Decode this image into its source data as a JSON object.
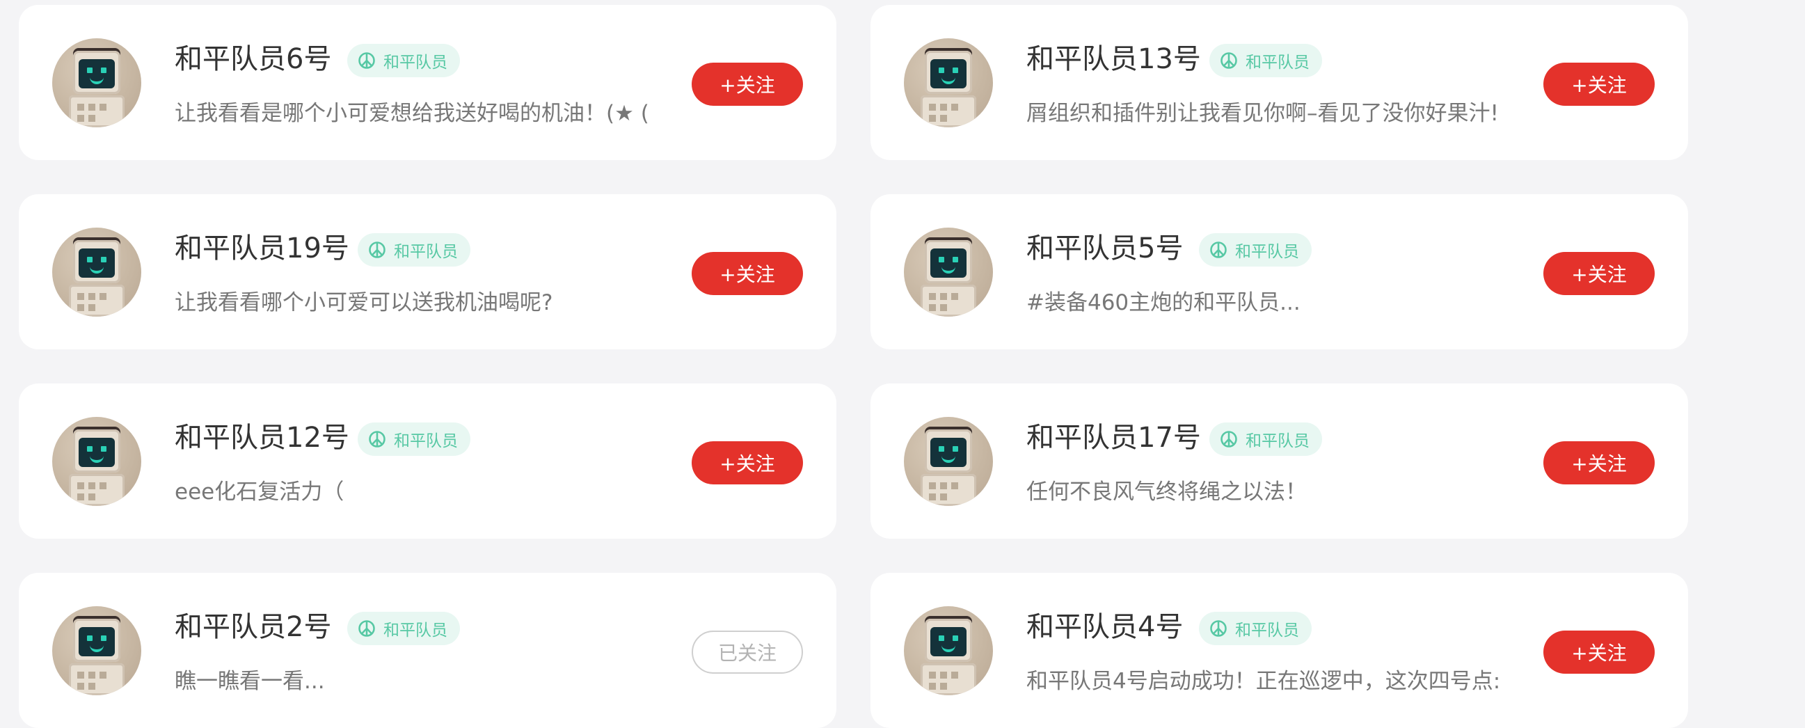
{
  "colors": {
    "accent_red": "#e4322b",
    "badge_text": "#57c8a4",
    "badge_bg": "#e8f7f2",
    "background": "#f4f4f6"
  },
  "cards": [
    {
      "name": "和平队员6号",
      "badge": "和平队员",
      "desc": "让我看看是哪个小可爱想给我送好喝的机油！(★ (",
      "follow_label": "+关注",
      "followed": false
    },
    {
      "name": "和平队员13号",
      "badge": "和平队员",
      "desc": "屑组织和插件别让我看见你啊–看见了没你好果汁!",
      "follow_label": "+关注",
      "followed": false
    },
    {
      "name": "和平队员19号",
      "badge": "和平队员",
      "desc": "让我看看哪个小可爱可以送我机油喝呢?",
      "follow_label": "+关注",
      "followed": false
    },
    {
      "name": "和平队员5号",
      "badge": "和平队员",
      "desc": "#装备460主炮的和平队员...",
      "follow_label": "+关注",
      "followed": false
    },
    {
      "name": "和平队员12号",
      "badge": "和平队员",
      "desc": "eee化石复活力（",
      "follow_label": "+关注",
      "followed": false
    },
    {
      "name": "和平队员17号",
      "badge": "和平队员",
      "desc": "任何不良风气终将绳之以法！",
      "follow_label": "+关注",
      "followed": false
    },
    {
      "name": "和平队员2号",
      "badge": "和平队员",
      "desc": "瞧一瞧看一看...",
      "follow_label": "已关注",
      "followed": true
    },
    {
      "name": "和平队员4号",
      "badge": "和平队员",
      "desc": "和平队员4号启动成功！正在巡逻中，这次四号点:",
      "follow_label": "+关注",
      "followed": false
    }
  ]
}
